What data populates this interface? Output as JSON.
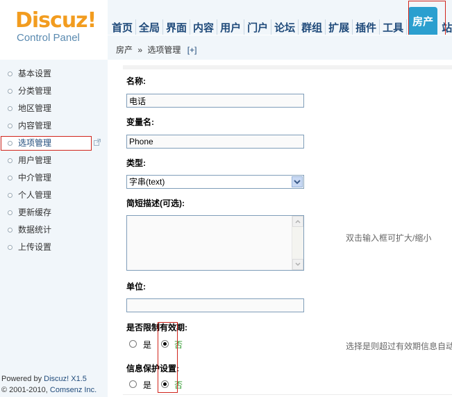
{
  "logo": {
    "brand": "Discuz",
    "bang": "!",
    "subtitle": "Control Panel"
  },
  "topnav": {
    "items": [
      "首页",
      "全局",
      "界面",
      "内容",
      "用户",
      "门户",
      "论坛",
      "群组",
      "扩展",
      "插件",
      "工具"
    ],
    "active": "房产",
    "cut": "站"
  },
  "breadcrumb": {
    "parent": "房产",
    "separator": "»",
    "current": "选项管理",
    "plus": "[+]"
  },
  "sidebar": {
    "items": [
      "基本设置",
      "分类管理",
      "地区管理",
      "内容管理",
      "选项管理",
      "用户管理",
      "中介管理",
      "个人管理",
      "更新缓存",
      "数据统计",
      "上传设置"
    ],
    "active_index": 4
  },
  "footer": {
    "powered": "Powered by ",
    "product": "Discuz! X1.5",
    "copy": "© 2001-2010, ",
    "company": "Comsenz Inc."
  },
  "form": {
    "name_label": "名称:",
    "name_value": "电话",
    "var_label": "变量名:",
    "var_value": "Phone",
    "type_label": "类型:",
    "type_value": "字串(text)",
    "desc_label": "简短描述(可选):",
    "desc_hint": "双击输入框可扩大/缩小",
    "unit_label": "单位:",
    "unit_value": "",
    "expire_label": "是否限制有效期:",
    "expire_yes": "是",
    "expire_no": "否",
    "expire_hint": "选择是则超过有效期信息自动",
    "protect_label": "信息保护设置:",
    "protect_yes": "是",
    "protect_no": "否"
  }
}
